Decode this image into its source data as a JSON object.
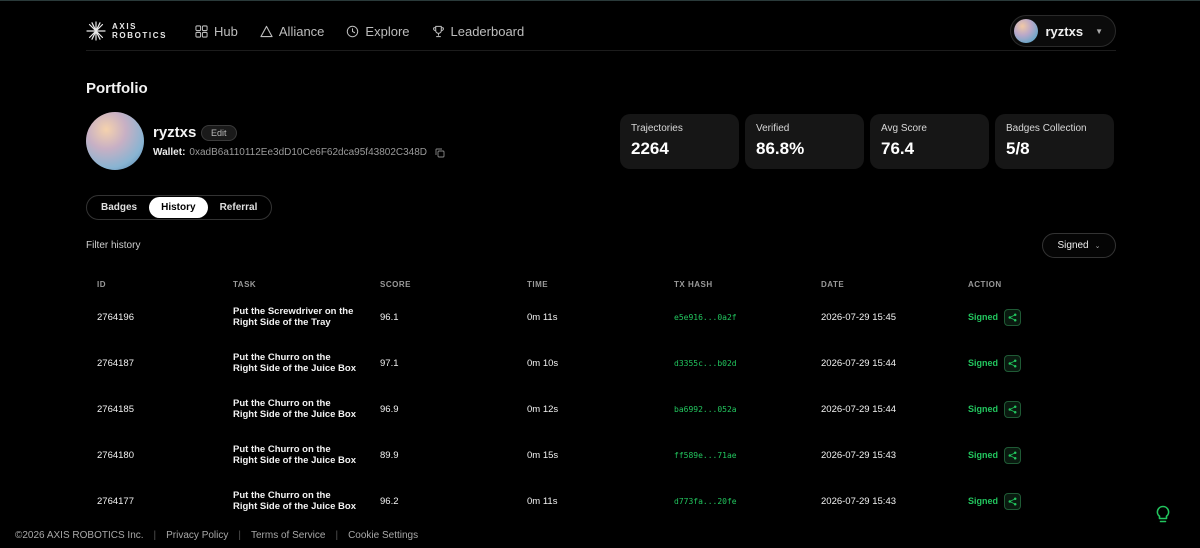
{
  "brand": {
    "line1": "AXIS",
    "line2": "ROBOTICS"
  },
  "nav": [
    {
      "label": "Hub",
      "icon": "grid-icon"
    },
    {
      "label": "Alliance",
      "icon": "triangle-icon"
    },
    {
      "label": "Explore",
      "icon": "clock-icon"
    },
    {
      "label": "Leaderboard",
      "icon": "trophy-icon"
    }
  ],
  "user": {
    "name": "ryztxs"
  },
  "page": {
    "title": "Portfolio"
  },
  "profile": {
    "name": "ryztxs",
    "edit_label": "Edit",
    "wallet_label": "Wallet:",
    "wallet_address": "0xadB6a110112Ee3dD10Ce6F62dca95f43802C348D"
  },
  "stats": [
    {
      "label": "Trajectories",
      "value": "2264"
    },
    {
      "label": "Verified",
      "value": "86.8%"
    },
    {
      "label": "Avg Score",
      "value": "76.4"
    },
    {
      "label": "Badges Collection",
      "value": "5/8"
    }
  ],
  "tabs": [
    {
      "label": "Badges",
      "active": false
    },
    {
      "label": "History",
      "active": true
    },
    {
      "label": "Referral",
      "active": false
    }
  ],
  "filter": {
    "label": "Filter history",
    "selected": "Signed"
  },
  "table": {
    "headers": {
      "id": "ID",
      "task": "TASK",
      "score": "SCORE",
      "time": "TIME",
      "hash": "TX HASH",
      "date": "DATE",
      "action": "ACTION"
    },
    "rows": [
      {
        "id": "2764196",
        "task1": "Put the Screwdriver on the",
        "task2": "Right Side of the Tray",
        "score": "96.1",
        "time": "0m 11s",
        "hash": "e5e916...0a2f",
        "date": "2026-07-29 15:45",
        "action": "Signed"
      },
      {
        "id": "2764187",
        "task1": "Put the Churro on the",
        "task2": "Right Side of the Juice Box",
        "score": "97.1",
        "time": "0m 10s",
        "hash": "d3355c...b02d",
        "date": "2026-07-29 15:44",
        "action": "Signed"
      },
      {
        "id": "2764185",
        "task1": "Put the Churro on the",
        "task2": "Right Side of the Juice Box",
        "score": "96.9",
        "time": "0m 12s",
        "hash": "ba6992...052a",
        "date": "2026-07-29 15:44",
        "action": "Signed"
      },
      {
        "id": "2764180",
        "task1": "Put the Churro on the",
        "task2": "Right Side of the Juice Box",
        "score": "89.9",
        "time": "0m 15s",
        "hash": "ff589e...71ae",
        "date": "2026-07-29 15:43",
        "action": "Signed"
      },
      {
        "id": "2764177",
        "task1": "Put the Churro on the",
        "task2": "Right Side of the Juice Box",
        "score": "96.2",
        "time": "0m 11s",
        "hash": "d773fa...20fe",
        "date": "2026-07-29 15:43",
        "action": "Signed"
      }
    ]
  },
  "footer": {
    "copyright": "©2026 AXIS ROBOTICS Inc.",
    "privacy": "Privacy Policy",
    "terms": "Terms of Service",
    "cookies": "Cookie Settings"
  },
  "colors": {
    "accent_green": "#22c55e",
    "background": "#000000",
    "card": "#161616"
  }
}
